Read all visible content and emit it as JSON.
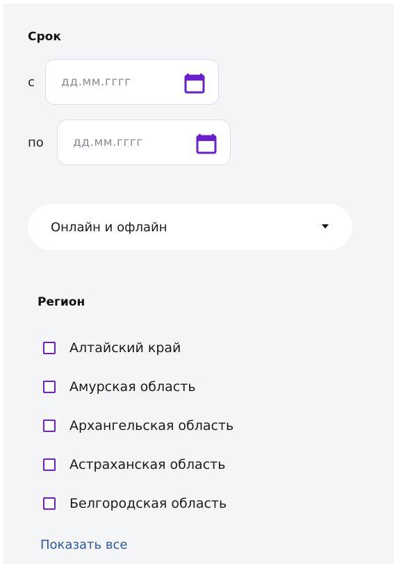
{
  "term": {
    "title": "Срок",
    "from": {
      "prefix": "с",
      "placeholder": "дд.мм.гггг"
    },
    "to": {
      "prefix": "по",
      "placeholder": "дд.мм.гггг"
    }
  },
  "format_select": {
    "value": "Онлайн и офлайн"
  },
  "region": {
    "title": "Регион",
    "items": [
      {
        "label": "Алтайский край"
      },
      {
        "label": "Амурская область"
      },
      {
        "label": "Архангельская область"
      },
      {
        "label": "Астраханская область"
      },
      {
        "label": "Белгородская область"
      }
    ],
    "show_all": "Показать все"
  },
  "colors": {
    "accent": "#6a1fd0",
    "link": "#2b57a8",
    "panel_bg": "#f4f5f7"
  }
}
